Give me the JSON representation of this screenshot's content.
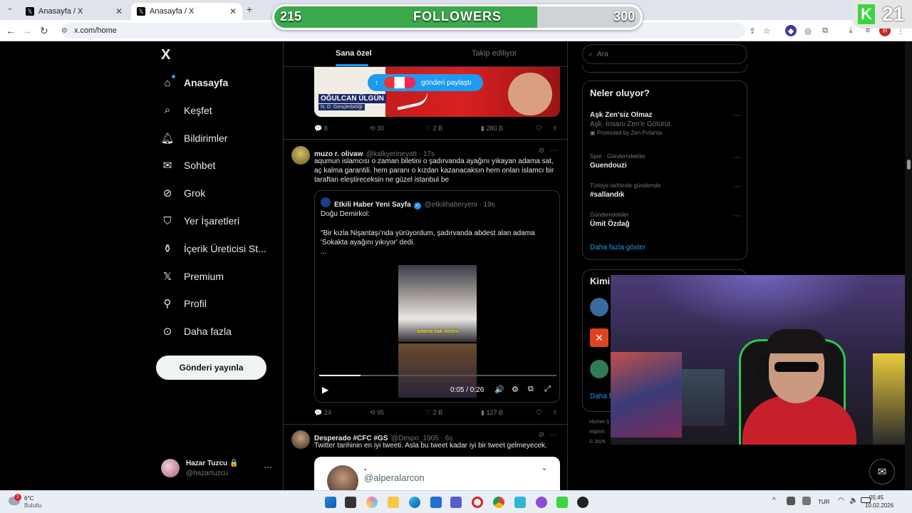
{
  "browser": {
    "tabs": [
      {
        "label": "Anasayfa / X",
        "active": false
      },
      {
        "label": "Anasayfa / X",
        "active": true
      }
    ],
    "url": "x.com/home"
  },
  "overlay": {
    "current": "215",
    "label": "FOLLOWERS",
    "goal": "300",
    "progress_fraction": 0.717,
    "badge_number": "21"
  },
  "nav": {
    "logo": "X",
    "items": [
      {
        "label": "Anasayfa",
        "icon": "home-icon",
        "active": true
      },
      {
        "label": "Keşfet",
        "icon": "search-icon"
      },
      {
        "label": "Bildirimler",
        "icon": "bell-icon"
      },
      {
        "label": "Sohbet",
        "icon": "mail-icon"
      },
      {
        "label": "Grok",
        "icon": "grok-icon"
      },
      {
        "label": "Yer İşaretleri",
        "icon": "bookmark-icon"
      },
      {
        "label": "İçerik Üreticisi St...",
        "icon": "creator-icon"
      },
      {
        "label": "Premium",
        "icon": "x-icon"
      },
      {
        "label": "Profil",
        "icon": "person-icon"
      },
      {
        "label": "Daha fazla",
        "icon": "more-circle-icon"
      }
    ],
    "post_button": "Gönderi yayınla",
    "account": {
      "name": "Hazar Tuzcu 🔒",
      "handle": "@hazartuzcu"
    }
  },
  "feed": {
    "tabs": [
      "Sana özel",
      "Takip ediliyor"
    ],
    "new_posts_pill": "gönderi paylaştı",
    "top_card": {
      "player": "OĞULCAN ÜLGÜN",
      "club": "N. D. Gençlerbirliği"
    },
    "tweet0_actions": {
      "replies": "8",
      "reposts": "30",
      "likes": "2 B",
      "views": "280 B"
    },
    "tweet1": {
      "name": "muzo r. olivaw",
      "handle": "@kalkyerineyatt · 17s",
      "text": "aqumun islamcısı o zaman biletini o şadırvanda ayağını yıkayan adama sat, aç kalma garantili. hem paranı o kızdan kazanacaksın hem onları islamcı bir taraftan eleştireceksin ne güzel istanbul be",
      "quote": {
        "name": "Etkili Haber Yeni Sayfa",
        "handle": "@etkilihaberyeni · 19s",
        "line1": "Doğu Demirkol:",
        "line2": "\"Bir kızla Nişantaşı'nda yürüyordum, şadırvanda abdest alan adama 'Sokakta ayağını yıkıyor' dedi.",
        "line3": "...",
        "subtitle": "adama bak dedim",
        "time": "0:05 / 0:26"
      },
      "actions": {
        "replies": "24",
        "reposts": "95",
        "likes": "2 B",
        "views": "127 B"
      }
    },
    "tweet2": {
      "name": "Desperado #CFC #GS",
      "handle": "@Despo_1905 · 6s",
      "text": "Twitter tarihinin en iyi tweeti. Asla bu tweet kadar iyi bir tweet gelmeyecek.",
      "embed_dot": ".",
      "embed_handle": "@alperalarcon"
    }
  },
  "right": {
    "search_placeholder": "Ara",
    "trends_title": "Neler oluyor?",
    "trends": [
      {
        "meta": "",
        "title": "Aşk Zen'siz Olmaz",
        "sub": "Aşk, İnsanı Zen'e Götürür.",
        "promo": "Promoted by Zen Pırlanta"
      },
      {
        "meta": "Spor · Gündemdekiler",
        "title": "Guendouzi"
      },
      {
        "meta": "Türkiye tarihinde gündemde",
        "title": "#sallandık"
      },
      {
        "meta": "Gündemdekiler",
        "title": "Ümit Özdağ"
      }
    ],
    "show_more": "Daha fazla göster",
    "who_title": "Kimi",
    "who_more": "Daha f",
    "footer": [
      "Hizmet Ş",
      "Imprint",
      "© 2026"
    ]
  },
  "taskbar": {
    "weather_temp": "6°C",
    "weather_text": "Bulutlu",
    "weather_badge": "1",
    "lang": "TUR",
    "time": "05:45",
    "date": "10.02.2026"
  },
  "colors": {
    "accent": "#1d9bf0",
    "overlay_green": "#3aa94a",
    "background": "#000000"
  }
}
